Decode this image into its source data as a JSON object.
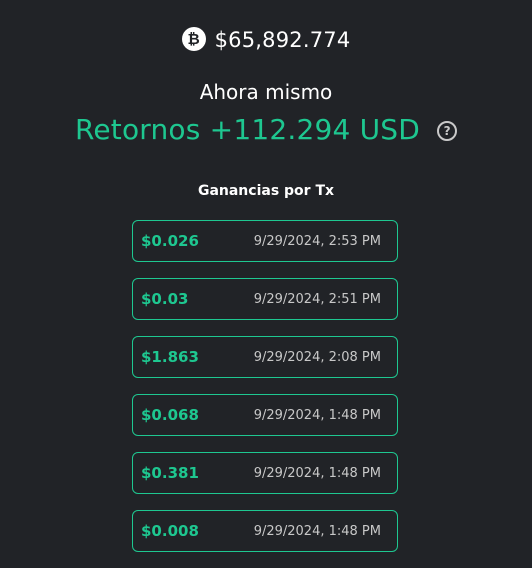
{
  "header": {
    "currency_icon": "bitcoin-icon",
    "currency_symbol": "₿",
    "btc_price": "$65,892.774",
    "subtitle": "Ahora mismo",
    "returns": "Retornos +112.294 USD",
    "help_icon": "question-circle-icon",
    "help_symbol": "?"
  },
  "section_title": "Ganancias por Tx",
  "transactions": [
    {
      "amount": "$0.026",
      "time": "9/29/2024, 2:53 PM"
    },
    {
      "amount": "$0.03",
      "time": "9/29/2024, 2:51 PM"
    },
    {
      "amount": "$1.863",
      "time": "9/29/2024, 2:08 PM"
    },
    {
      "amount": "$0.068",
      "time": "9/29/2024, 1:48 PM"
    },
    {
      "amount": "$0.381",
      "time": "9/29/2024, 1:48 PM"
    },
    {
      "amount": "$0.008",
      "time": "9/29/2024, 1:48 PM"
    }
  ],
  "colors": {
    "background": "#212327",
    "accent_green": "#1ec790",
    "text": "#ffffff",
    "muted_text": "#c8c8c8"
  }
}
